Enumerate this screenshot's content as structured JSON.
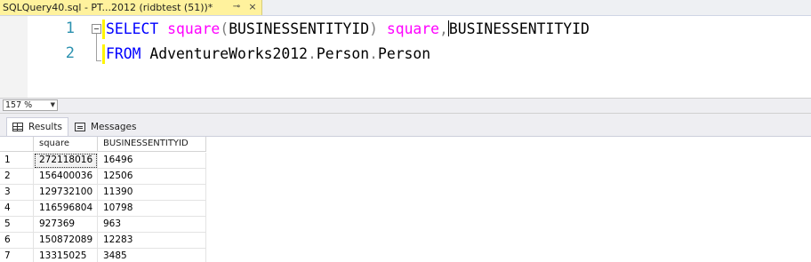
{
  "tab": {
    "title": "SQLQuery40.sql - PT...2012 (ridbtest (51))*",
    "pin_icon": "pin-icon",
    "close_icon": "close-icon"
  },
  "editor": {
    "line_numbers": [
      "1",
      "2"
    ],
    "line1": {
      "select_kw": "SELECT",
      "fn_square": "square",
      "open_paren": "(",
      "arg": "BUSINESSENTITYID",
      "close_paren": ")",
      "alias": "square",
      "comma": ",",
      "col2": "BUSINESSENTITYID"
    },
    "line2": {
      "from_kw": "FROM",
      "db": "AdventureWorks2012",
      "dot1": ".",
      "schema": "Person",
      "dot2": ".",
      "table": "Person"
    }
  },
  "zoom": {
    "value": "157 %"
  },
  "results_tabs": [
    {
      "label": "Results",
      "icon": "grid-icon"
    },
    {
      "label": "Messages",
      "icon": "messages-icon"
    }
  ],
  "grid": {
    "columns": [
      "",
      "square",
      "BUSINESSENTITYID"
    ],
    "rows": [
      [
        "1",
        "272118016",
        "16496"
      ],
      [
        "2",
        "156400036",
        "12506"
      ],
      [
        "3",
        "129732100",
        "11390"
      ],
      [
        "4",
        "116596804",
        "10798"
      ],
      [
        "5",
        "927369",
        "963"
      ],
      [
        "6",
        "150872089",
        "12283"
      ],
      [
        "7",
        "13315025",
        "3485"
      ]
    ]
  },
  "colors": {
    "keyword": "#0000ff",
    "function": "#ff00ff",
    "line_number": "#2b91af",
    "tab_background": "#fff29d"
  }
}
